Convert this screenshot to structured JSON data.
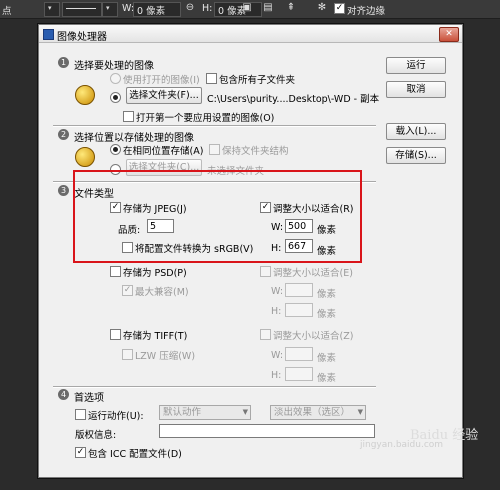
{
  "toolbar": {
    "tool_label": "点",
    "w_label": "W:",
    "w_value": "0 像素",
    "h_label": "H:",
    "h_value": "0 像素",
    "align_edges_label": "对齐边缘"
  },
  "dialog": {
    "title": "图像处理器",
    "close_glyph": "✕"
  },
  "section1": {
    "number": "1",
    "title": "选择要处理的图像",
    "use_open_images": "使用打开的图像(I)",
    "include_subfolders": "包含所有子文件夹",
    "select_folder_button": "选择文件夹(F)...",
    "folder_path": "C:\\Users\\purity....Desktop\\-WD - 副本",
    "open_first_image": "打开第一个要应用设置的图像(O)"
  },
  "section2": {
    "number": "2",
    "title": "选择位置以存储处理的图像",
    "save_same_location": "在相同位置存储(A)",
    "keep_structure": "保持文件夹结构",
    "select_folder_button": "选择文件夹(C)...",
    "no_folder_selected": "未选择文件夹"
  },
  "section3": {
    "number": "3",
    "title": "文件类型",
    "jpeg": {
      "save_as": "存储为 JPEG(J)",
      "resize_to_fit": "调整大小以适合(R)",
      "quality_label": "品质:",
      "quality_value": "5",
      "w_label": "W:",
      "w_value": "500",
      "w_unit": "像素",
      "h_label": "H:",
      "h_value": "667",
      "h_unit": "像素",
      "convert_srgb": "将配置文件转换为 sRGB(V)"
    },
    "psd": {
      "save_as": "存储为 PSD(P)",
      "resize_to_fit": "调整大小以适合(E)",
      "maximize_compat": "最大兼容(M)",
      "w_label": "W:",
      "w_unit": "像素",
      "h_label": "H:",
      "h_unit": "像素"
    },
    "tiff": {
      "save_as": "存储为 TIFF(T)",
      "resize_to_fit": "调整大小以适合(Z)",
      "lzw": "LZW 压缩(W)",
      "w_label": "W:",
      "w_unit": "像素",
      "h_label": "H:",
      "h_unit": "像素"
    }
  },
  "section4": {
    "number": "4",
    "title": "首选项",
    "run_action": "运行动作(U):",
    "action_set": "默认动作",
    "action": "淡出效果（选区）",
    "copyright_label": "版权信息:",
    "copyright_value": "",
    "include_icc": "包含 ICC 配置文件(D)"
  },
  "buttons": {
    "run": "运行",
    "cancel": "取消",
    "load": "载入(L)...",
    "save": "存储(S)..."
  },
  "watermark": {
    "logo": "Baidu 经验",
    "url": "jingyan.baidu.com"
  }
}
